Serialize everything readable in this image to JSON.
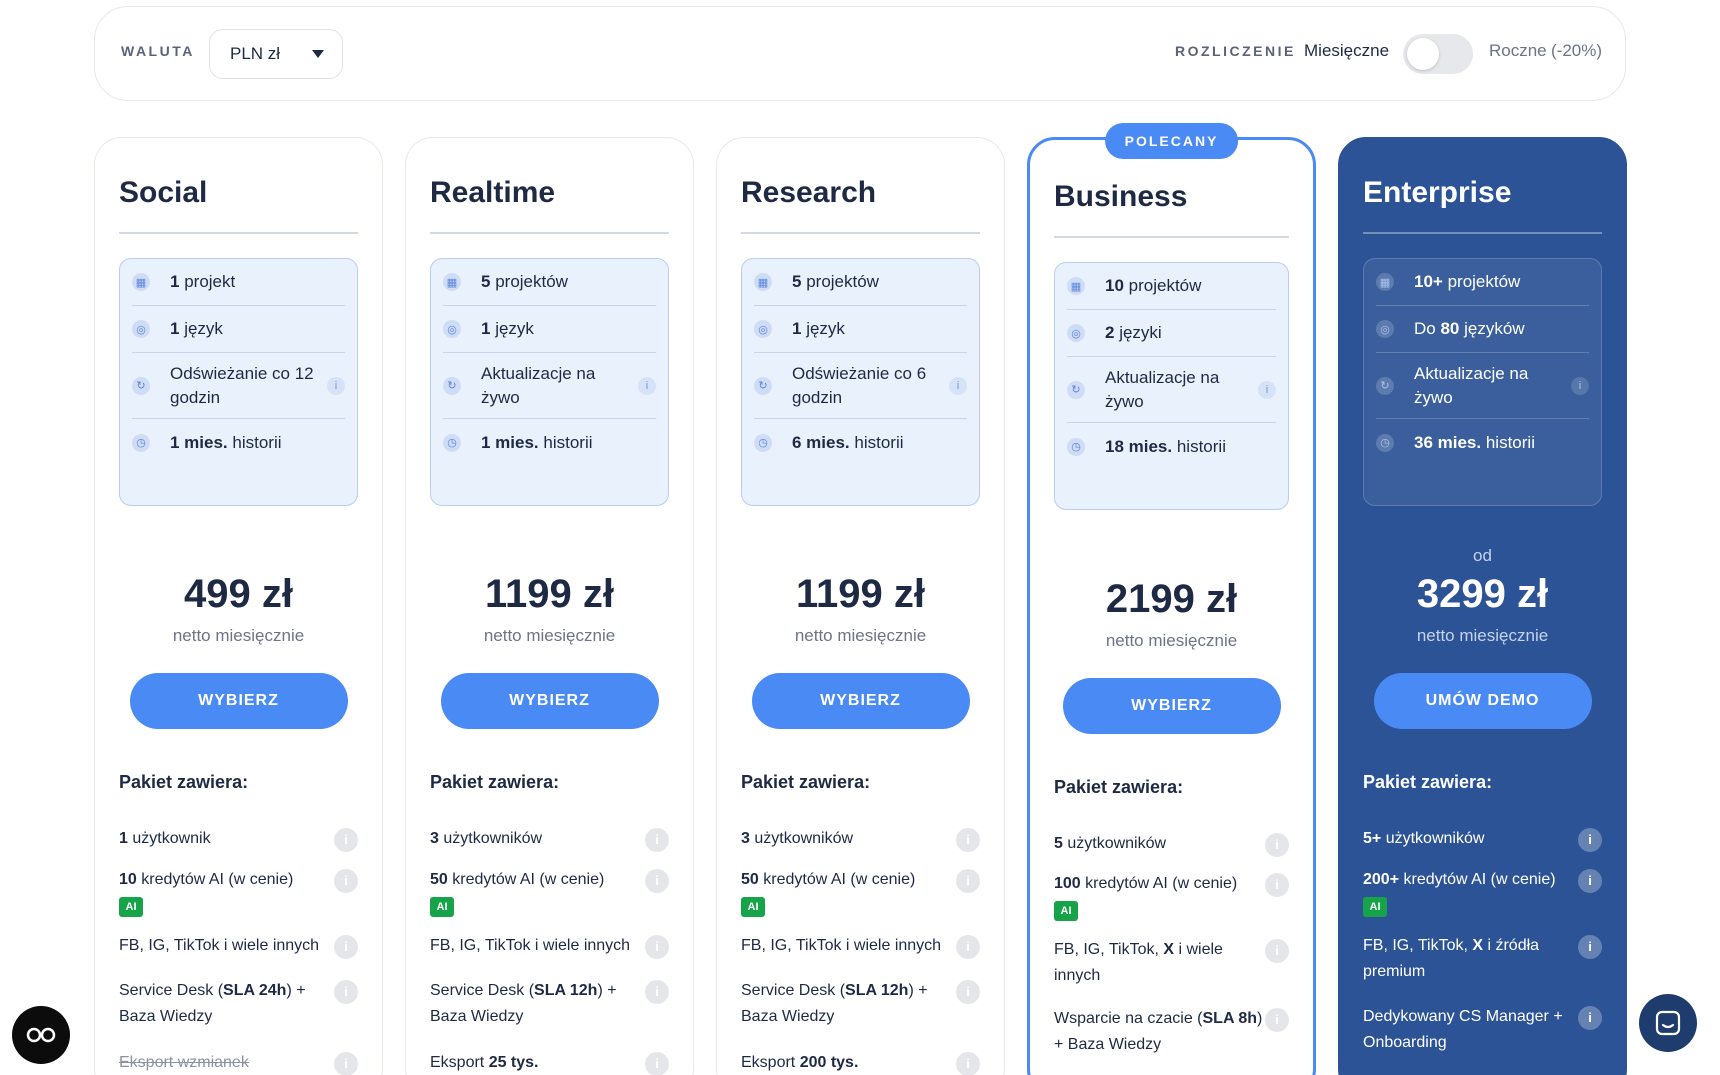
{
  "currency": {
    "label": "WALUTA",
    "selected": "PLN zł"
  },
  "billing": {
    "label": "ROZLICZENIE",
    "monthly": "Miesięczne",
    "yearly": "Roczne",
    "discount": "(-20%)",
    "yearly_enabled": false
  },
  "common": {
    "price_note": "netto miesięcznie",
    "included_title": "Pakiet zawiera:",
    "ai_tag": "AI",
    "info_glyph": "i"
  },
  "colors": {
    "accent": "#4a8af4",
    "dark_card": "#2c5395",
    "text": "#1e2a44",
    "ai_green": "#17a34a"
  },
  "plans": [
    {
      "name": "Social",
      "specs": {
        "projects_num": "1",
        "projects_txt": "projekt",
        "lang_pre": "",
        "lang_num": "1",
        "lang_txt": "język",
        "refresh": "Odświeżanie co 12 godzin",
        "history_num": "1 mies.",
        "history_txt": "historii"
      },
      "price": "499 zł",
      "cta": "WYBIERZ",
      "features": [
        {
          "b": "1",
          "t": " użytkownik"
        },
        {
          "b": "10",
          "t": " kredytów AI (w cenie)"
        },
        {
          "t": "FB, IG, TikTok i wiele innych"
        },
        {
          "t1": "Service Desk (",
          "b": "SLA 24h",
          "t2": ") + Baza Wiedzy"
        },
        {
          "t": "Eksport wzmianek"
        }
      ]
    },
    {
      "name": "Realtime",
      "specs": {
        "projects_num": "5",
        "projects_txt": "projektów",
        "lang_pre": "",
        "lang_num": "1",
        "lang_txt": "język",
        "refresh": "Aktualizacje na żywo",
        "history_num": "1 mies.",
        "history_txt": "historii"
      },
      "price": "1199 zł",
      "cta": "WYBIERZ",
      "features": [
        {
          "b": "3",
          "t": " użytkowników"
        },
        {
          "b": "50",
          "t": " kredytów AI (w cenie)"
        },
        {
          "t": "FB, IG, TikTok i wiele innych"
        },
        {
          "t1": "Service Desk (",
          "b": "SLA 12h",
          "t2": ") + Baza Wiedzy"
        },
        {
          "t": "Eksport ",
          "b": "25 tys."
        }
      ]
    },
    {
      "name": "Research",
      "specs": {
        "projects_num": "5",
        "projects_txt": "projektów",
        "lang_pre": "",
        "lang_num": "1",
        "lang_txt": "język",
        "refresh": "Odświeżanie co 6 godzin",
        "history_num": "6 mies.",
        "history_txt": "historii"
      },
      "price": "1199 zł",
      "cta": "WYBIERZ",
      "features": [
        {
          "b": "3",
          "t": " użytkowników"
        },
        {
          "b": "50",
          "t": " kredytów AI (w cenie)"
        },
        {
          "t": "FB, IG, TikTok i wiele innych"
        },
        {
          "t1": "Service Desk (",
          "b": "SLA 12h",
          "t2": ") + Baza Wiedzy"
        },
        {
          "t": "Eksport ",
          "b": "200 tys."
        }
      ]
    },
    {
      "name": "Business",
      "badge": "POLECANY",
      "specs": {
        "projects_num": "10",
        "projects_txt": "projektów",
        "lang_pre": "",
        "lang_num": "2",
        "lang_txt": "języki",
        "refresh": "Aktualizacje na żywo",
        "history_num": "18 mies.",
        "history_txt": "historii"
      },
      "price": "2199 zł",
      "cta": "WYBIERZ",
      "features": [
        {
          "b": "5",
          "t": " użytkowników"
        },
        {
          "b": "100",
          "t": " kredytów AI (w cenie)"
        },
        {
          "t1": "FB, IG, TikTok, ",
          "b": "X",
          "t2": " i wiele innych"
        },
        {
          "t1": "Wsparcie na czacie (",
          "b": "SLA 8h",
          "t2": ") + Baza Wiedzy"
        }
      ]
    },
    {
      "name": "Enterprise",
      "specs": {
        "projects_num": "10+",
        "projects_txt": "projektów",
        "lang_pre": "Do ",
        "lang_num": "80",
        "lang_txt": "języków",
        "refresh": "Aktualizacje na żywo",
        "history_num": "36 mies.",
        "history_txt": "historii"
      },
      "price_from": "od",
      "price": "3299 zł",
      "cta": "UMÓW DEMO",
      "features": [
        {
          "b": "5+",
          "t": " użytkowników"
        },
        {
          "b": "200+",
          "t": " kredytów AI (w cenie)"
        },
        {
          "t1": "FB, IG, TikTok, ",
          "b": "X",
          "t2": " i źródła premium"
        },
        {
          "t": "Dedykowany CS Manager + Onboarding"
        }
      ]
    }
  ]
}
